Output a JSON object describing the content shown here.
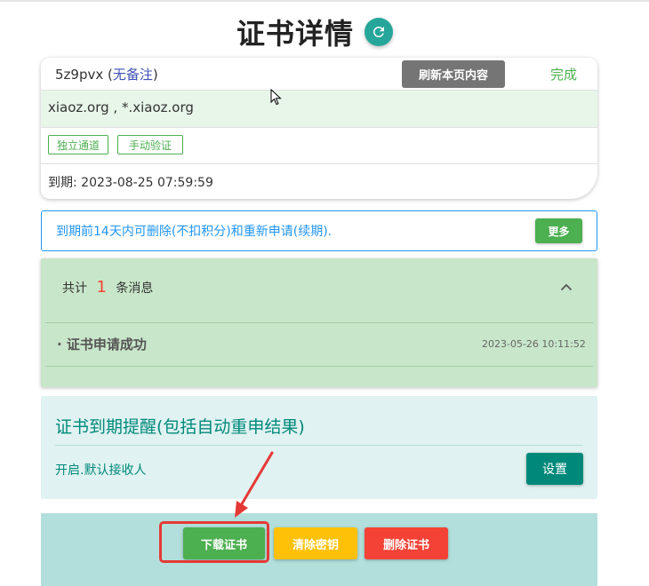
{
  "page": {
    "title": "证书详情"
  },
  "cert": {
    "id": "5z9pvx",
    "note": "无备注",
    "refresh_label": "刷新本页内容",
    "status": "完成",
    "domains": "xiaoz.org , *.xiaoz.org",
    "tags": [
      "独立通道",
      "手动验证"
    ],
    "expiry": "到期: 2023-08-25 07:59:59"
  },
  "notice": {
    "text": "到期前14天内可删除(不扣积分)和重新申请(续期).",
    "more_label": "更多"
  },
  "messages": {
    "prefix": "共计",
    "count": "1",
    "suffix": "条消息",
    "items": [
      {
        "text": "证书申请成功",
        "time": "2023-05-26 10:11:52"
      }
    ]
  },
  "reminder": {
    "title": "证书到期提醒(包括自动重申结果)",
    "status": "开启.默认接收人",
    "settings_label": "设置"
  },
  "actions": {
    "download_label": "下载证书",
    "clear_key_label": "清除密钥",
    "delete_label": "删除证书"
  },
  "colors": {
    "green": "#4caf50",
    "teal": "#00897b",
    "amber": "#ffc107",
    "red": "#f44336",
    "blue": "#2196f3",
    "annotation_red": "#e53935"
  },
  "icons": [
    "refresh-icon",
    "chevron-up-icon",
    "mouse-cursor-icon",
    "annotation-arrow"
  ]
}
